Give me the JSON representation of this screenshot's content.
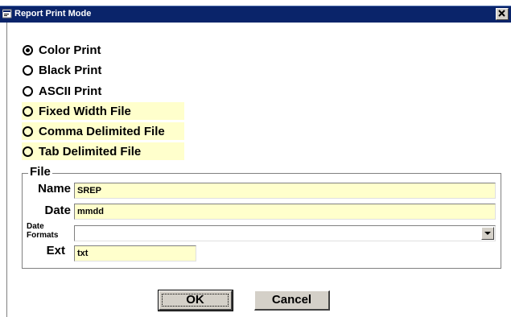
{
  "window": {
    "title": "Report Print Mode"
  },
  "options": [
    {
      "label": "Color Print",
      "checked": true,
      "highlighted": false
    },
    {
      "label": "Black Print",
      "checked": false,
      "highlighted": false
    },
    {
      "label": "ASCII Print",
      "checked": false,
      "highlighted": false
    },
    {
      "label": "Fixed Width File",
      "checked": false,
      "highlighted": true
    },
    {
      "label": "Comma Delimited File",
      "checked": false,
      "highlighted": true
    },
    {
      "label": "Tab Delimited File",
      "checked": false,
      "highlighted": true
    }
  ],
  "file_group": {
    "legend": "File",
    "name_label": "Name",
    "name_value": "SREP",
    "date_label": "Date",
    "date_value": "mmdd",
    "formats_label_1": "Date",
    "formats_label_2": "Formats",
    "formats_value": "",
    "ext_label": "Ext",
    "ext_value": "txt"
  },
  "buttons": {
    "ok": "OK",
    "cancel": "Cancel"
  },
  "colors": {
    "titlebar": "#0a246a",
    "field_bg": "#ffffcc",
    "button_face": "#d4d0c8"
  },
  "icons": {
    "window": "window-app-icon",
    "close": "close-icon",
    "dropdown": "chevron-down-icon"
  }
}
